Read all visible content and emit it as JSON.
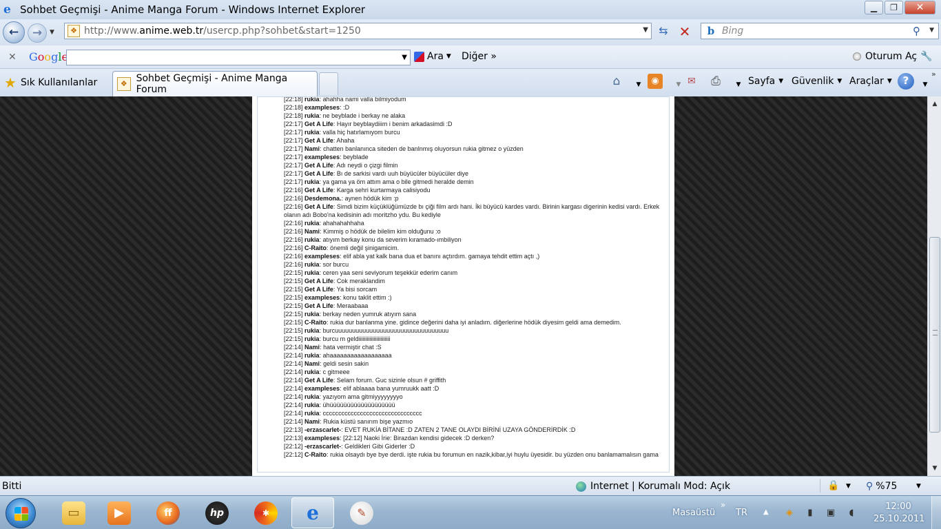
{
  "window": {
    "title": "Sohbet Geçmişi - Anime Manga Forum - Windows Internet Explorer",
    "controls": [
      "minimize",
      "maximize",
      "close"
    ]
  },
  "address": {
    "url_prefix": "http://www.",
    "url_domain": "anime.web.tr",
    "url_path": "/usercp.php?sohbet&start=1250"
  },
  "search": {
    "placeholder": "Bing"
  },
  "google_toolbar": {
    "logo": "Google",
    "search_label": "Ara",
    "more_label": "Diğer »",
    "signin_label": "Oturum Aç"
  },
  "tabs": {
    "favorites_label": "Sık Kullanılanlar",
    "active_tab": "Sohbet Geçmişi - Anime Manga Forum"
  },
  "commands": {
    "page": "Sayfa",
    "safety": "Güvenlik",
    "tools": "Araçlar"
  },
  "chat": {
    "messages": [
      {
        "time": "[22:18]",
        "user": "rukia",
        "text": "ahahha nami valla bilmiyodum"
      },
      {
        "time": "[22:18]",
        "user": "exampleses",
        "text": ":D"
      },
      {
        "time": "[22:18]",
        "user": "rukia",
        "text": "ne beyblade i berkay ne alaka"
      },
      {
        "time": "[22:17]",
        "user": "Get A Life",
        "text": "Hayır beyblaydiiim i benim arkadasimdi :D"
      },
      {
        "time": "[22:17]",
        "user": "rukia",
        "text": "valla hiç hatırlamıyom burcu"
      },
      {
        "time": "[22:17]",
        "user": "Get A Life",
        "text": "Ahaha"
      },
      {
        "time": "[22:17]",
        "user": "Nami",
        "text": "chatten banlanınca siteden de banlnmış oluyorsun rukia gitmez o yüzden"
      },
      {
        "time": "[22:17]",
        "user": "exampleses",
        "text": "beyblade"
      },
      {
        "time": "[22:17]",
        "user": "Get A Life",
        "text": "Adı neydi o çizgi filmin"
      },
      {
        "time": "[22:17]",
        "user": "Get A Life",
        "text": "Bı de sarkisi vardı uuh büyücüler büyücüler diye"
      },
      {
        "time": "[22:17]",
        "user": "rukia",
        "text": "ya gama ya öm attım ama o bile gitmedi heralde demin"
      },
      {
        "time": "[22:16]",
        "user": "Get A Life",
        "text": "Karga sehri kurtarmaya calisiyodu"
      },
      {
        "time": "[22:16]",
        "user": "Desdemona.",
        "text": "aynen hödük kim :p"
      },
      {
        "time": "[22:16]",
        "user": "Get A Life",
        "text": "Simdi bizim küçüklüğümüzde bı çiği film ardı hani. İki büyücü kardes vardı. Birinin kargası digerinin kedisi vardı. Erkek olanın adı Bobo'na kedisinin adı moritzho ydu. Bu kediyle"
      },
      {
        "time": "[22:16]",
        "user": "rukia",
        "text": "ahahahahhaha"
      },
      {
        "time": "[22:16]",
        "user": "Nami",
        "text": "Kimmiş o hödük de bilelim kim olduğunu :o"
      },
      {
        "time": "[22:16]",
        "user": "rukia",
        "text": "atıyım berkay konu da severim kıramado-ımbiliyon"
      },
      {
        "time": "[22:16]",
        "user": "C-Raito",
        "text": "önemli değil şinigamicim."
      },
      {
        "time": "[22:16]",
        "user": "exampleses",
        "text": "elif abla yat kalk bana dua et banını açtırdım. gamaya tehdit ettim açtı ,)"
      },
      {
        "time": "[22:16]",
        "user": "rukia",
        "text": "sor burcu"
      },
      {
        "time": "[22:15]",
        "user": "rukia",
        "text": "ceren yaa seni seviyorum teşekkür ederim canım"
      },
      {
        "time": "[22:15]",
        "user": "Get A Life",
        "text": "Cok meraklandim"
      },
      {
        "time": "[22:15]",
        "user": "Get A Life",
        "text": "Ya bisi sorcam"
      },
      {
        "time": "[22:15]",
        "user": "exampleses",
        "text": "konu taklit ettim :)"
      },
      {
        "time": "[22:15]",
        "user": "Get A Life",
        "text": "Meraabaaa"
      },
      {
        "time": "[22:15]",
        "user": "rukia",
        "text": "berkay neden yumruk atıyım sana"
      },
      {
        "time": "[22:15]",
        "user": "C-Raito",
        "text": "rukia dur banlanma yine. gidince değerini daha iyi anladım. diğerlerine hödük diyesim geldi ama demedim."
      },
      {
        "time": "[22:15]",
        "user": "rukia",
        "text": "burcuuuuuuuuuuuuuuuuuuuuuuuuuuuuuuuuu"
      },
      {
        "time": "[22:15]",
        "user": "rukia",
        "text": "burcu m geldiiiiiiiiiiiiiiiiiiiiiii"
      },
      {
        "time": "[22:14]",
        "user": "Nami",
        "text": "hata vermiştir chat :S"
      },
      {
        "time": "[22:14]",
        "user": "rukia",
        "text": "ahaaaaaaaaaaaaaaaaaa"
      },
      {
        "time": "[22:14]",
        "user": "Nami",
        "text": "geldi sesin sakin"
      },
      {
        "time": "[22:14]",
        "user": "rukia",
        "text": "c gitmeee"
      },
      {
        "time": "[22:14]",
        "user": "Get A Life",
        "text": "Selam forum. Guc sizinle olsun # griffith"
      },
      {
        "time": "[22:14]",
        "user": "exampleses",
        "text": "elif ablaaaa bana yumruukk aatt :D"
      },
      {
        "time": "[22:14]",
        "user": "rukia",
        "text": "yazıyom ama gitmiyyyyyyyyo"
      },
      {
        "time": "[22:14]",
        "user": "rukia",
        "text": "ühüüüüüüüüüüüüüüüüüüü"
      },
      {
        "time": "[22:14]",
        "user": "rukia",
        "text": "cccccccccccccccccccccccccccccccc"
      },
      {
        "time": "[22:14]",
        "user": "Nami",
        "text": "Rukia küstü sanırım bişe yazmıo"
      },
      {
        "time": "[22:13]",
        "user": "-erzascarlet-",
        "text": "EVET RUKİA BİTANE :D ZATEN 2 TANE OLAYDI BİRİNİ UZAYA GÖNDERİRDİK :D"
      },
      {
        "time": "[22:13]",
        "user": "exampleses",
        "text": "[22:12] Naoki İrie: Birazdan kendisi gidecek :D derken?"
      },
      {
        "time": "[22:12]",
        "user": "-erzascarlet-",
        "text": "Geldikleri Gibi Giderler :D"
      },
      {
        "time": "[22:12]",
        "user": "C-Raito",
        "text": "rukia olsaydı bye bye derdi. işte rukia bu forumun en nazik,kibar,iyi huylu üyesidir. bu yüzden onu banlamamalısın gama"
      }
    ]
  },
  "status": {
    "text": "Bitti",
    "zone": "Internet | Korumalı Mod: Açık",
    "zoom": "%75"
  },
  "taskbar": {
    "desktop_label": "Masaüstü",
    "language": "TR",
    "time": "12:00",
    "date": "25.10.2011"
  }
}
